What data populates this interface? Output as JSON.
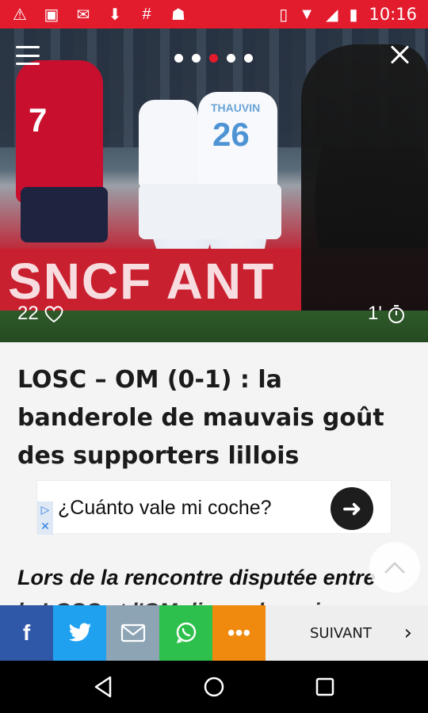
{
  "status_bar": {
    "time": "10:16",
    "icons_left": [
      "warning-icon",
      "image-icon",
      "gmail-icon",
      "download-icon",
      "hashtag-icon",
      "android-icon"
    ],
    "icons_right": [
      "vibrate-icon",
      "wifi-icon",
      "signal-icon",
      "battery-icon"
    ]
  },
  "hero": {
    "image_description": "football players celebrating",
    "pager_total": 5,
    "pager_active_index": 2,
    "likes": "22",
    "read_time": "1'",
    "jersey_number_left": "7",
    "jersey_name_right": "THAUVIN",
    "jersey_number_right": "26",
    "board_text": "SNCF ANT"
  },
  "article": {
    "title": "LOSC – OM (0-1) : la banderole de mauvais goût des supporters lillois",
    "lead": "Lors de la rencontre disputée entre",
    "lead_line2": "le LOSC et l'OM dimanche soir"
  },
  "ad": {
    "text": "¿Cuánto vale mi coche?"
  },
  "share_bar": {
    "next_label": "SUIVANT",
    "colors": {
      "facebook": "#2f58a8",
      "twitter": "#1fa1f0",
      "mail": "#8da4b5",
      "whatsapp": "#2ec04c",
      "more": "#f08a0f"
    }
  },
  "theme": {
    "accent": "#e21b2d"
  }
}
